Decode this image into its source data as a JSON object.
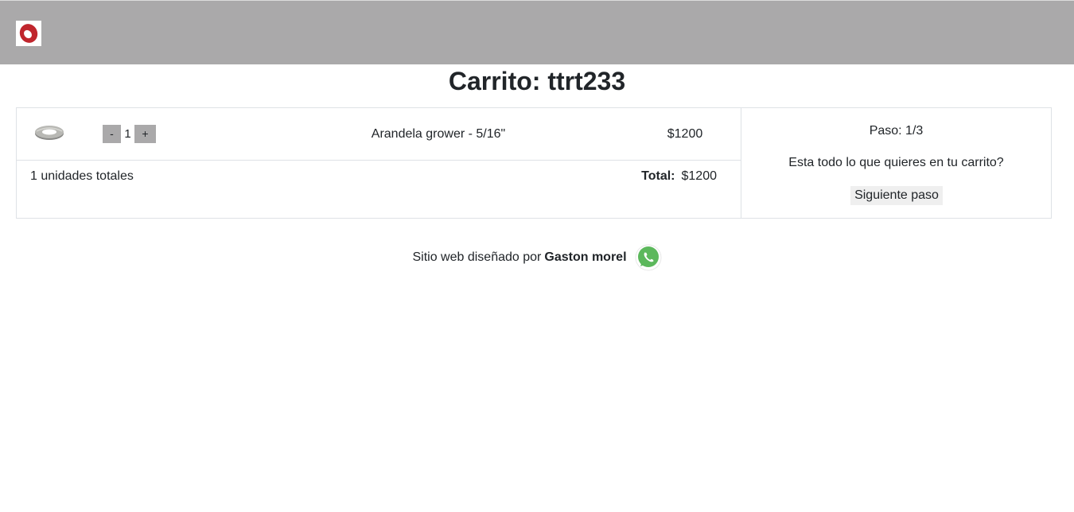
{
  "header": {
    "logo_icon": "brand-logo-icon"
  },
  "page": {
    "title": "Carrito: ttrt233"
  },
  "cart": {
    "items": [
      {
        "image_icon": "washer-icon",
        "qty_minus_label": "-",
        "quantity": "1",
        "qty_plus_label": "+",
        "name": "Arandela grower - 5/16\"",
        "price": "$1200"
      }
    ],
    "units_total": "1 unidades totales",
    "total_label": "Total:",
    "total_value": "$1200"
  },
  "steps": {
    "step": "Paso: 1/3",
    "question": "Esta todo lo que quieres en tu carrito?",
    "next_label": "Siguiente paso"
  },
  "footer": {
    "text": "Sitio web diseñado por",
    "author": "Gaston morel",
    "whatsapp_icon": "whatsapp-icon"
  },
  "colors": {
    "header_bg": "#aaa9aa",
    "logo_red": "#c0262d",
    "whatsapp_green": "#5cb85c"
  }
}
